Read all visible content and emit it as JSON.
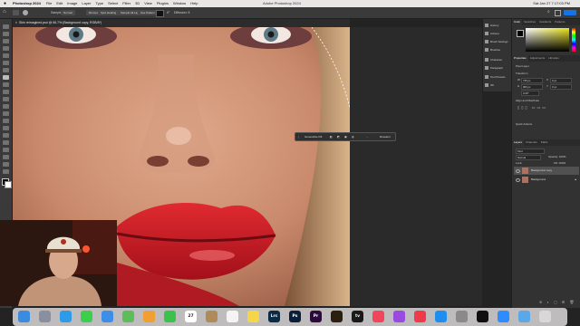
{
  "menubar": {
    "app_name": "Photoshop 2024",
    "menus": [
      "File",
      "Edit",
      "Image",
      "Layer",
      "Type",
      "Select",
      "Filter",
      "3D",
      "View",
      "Plugins",
      "Window",
      "Help"
    ],
    "window_title": "Adobe Photoshop 2024",
    "clock": "Sat Jan 27  7:17:03 PM"
  },
  "options": {
    "sample_label": "Sample:",
    "sample_value": "Normal",
    "btn_remove": "Remove",
    "btn_spot_heal": "Spot Healing",
    "btn_sample_all": "Sample All Layers",
    "btn_auto": "Use Pattern",
    "angle": "0°",
    "diffusion": "Diffusion:  5"
  },
  "document": {
    "tab_label": "Skin reimagined.psd @ 66.7% (Background copy, RGB/8*)"
  },
  "ctxbar": {
    "generative_fill": "Generative Fill",
    "deselect": "Deselect"
  },
  "dock_panels": [
    "History",
    "Actions",
    "Brush Settings",
    "Brushes",
    "Character",
    "Paragraph",
    "Tool Presets",
    "3D"
  ],
  "color_panel": {
    "tabs": [
      "Color",
      "Swatches",
      "Gradients",
      "Patterns"
    ]
  },
  "properties": {
    "tabs": [
      "Properties",
      "Adjustments",
      "Libraries"
    ],
    "pixel_layer": "Pixel Layer",
    "transform": "Transform",
    "w_label": "W",
    "w": "735 px",
    "h_label": "H",
    "h": "906 px",
    "x_label": "X",
    "x": "0 px",
    "y_label": "Y",
    "y": "0 px",
    "angle": "0.00°",
    "align": "Align and Distribute",
    "quick_actions": "Quick Actions"
  },
  "layers": {
    "tabs": [
      "Layers",
      "Channels",
      "Paths"
    ],
    "kind": "Kind",
    "blend": "Normal",
    "opacity": "Opacity: 100%",
    "lock": "Lock:",
    "fill": "Fill: 100%",
    "items": [
      {
        "name": "Background copy",
        "selected": true
      },
      {
        "name": "Background",
        "selected": false
      }
    ]
  },
  "macdock": {
    "apps": [
      {
        "name": "finder-icon",
        "label": "",
        "color": "#3b8be0"
      },
      {
        "name": "launchpad-icon",
        "label": "",
        "color": "#8a8fa0"
      },
      {
        "name": "safari-icon",
        "label": "",
        "color": "#2d9be8"
      },
      {
        "name": "messages-icon",
        "label": "",
        "color": "#3ccf4e"
      },
      {
        "name": "mail-icon",
        "label": "",
        "color": "#3b8fe8"
      },
      {
        "name": "maps-icon",
        "label": "",
        "color": "#5ebd5b"
      },
      {
        "name": "photos-icon",
        "label": "",
        "color": "#f0a030"
      },
      {
        "name": "facetime-icon",
        "label": "",
        "color": "#3ac24a"
      },
      {
        "name": "calendar-icon",
        "label": "27",
        "color": "#ffffff"
      },
      {
        "name": "contacts-icon",
        "label": "",
        "color": "#b08a5a"
      },
      {
        "name": "reminders-icon",
        "label": "",
        "color": "#f4f4f4"
      },
      {
        "name": "notes-icon",
        "label": "",
        "color": "#f6d649"
      },
      {
        "name": "lightroom-icon",
        "label": "Lrc",
        "color": "#0b2a44"
      },
      {
        "name": "photoshop-icon",
        "label": "Ps",
        "color": "#0a1e3a"
      },
      {
        "name": "premiere-icon",
        "label": "Pr",
        "color": "#2a0b3a"
      },
      {
        "name": "bridge-icon",
        "label": "",
        "color": "#2b1f10"
      },
      {
        "name": "appletv-icon",
        "label": "tv",
        "color": "#1a1a1a"
      },
      {
        "name": "music-icon",
        "label": "",
        "color": "#f2445a"
      },
      {
        "name": "podcasts-icon",
        "label": "",
        "color": "#9a4ae0"
      },
      {
        "name": "news-icon",
        "label": "",
        "color": "#f03a4a"
      },
      {
        "name": "appstore-icon",
        "label": "",
        "color": "#1e8ef0"
      },
      {
        "name": "settings-icon",
        "label": "",
        "color": "#8a8a8a"
      },
      {
        "name": "chatgpt-icon",
        "label": "",
        "color": "#101010"
      },
      {
        "name": "zoom-icon",
        "label": "",
        "color": "#2d8cff"
      },
      {
        "name": "folder-icon",
        "label": "",
        "color": "#5aa8e8"
      },
      {
        "name": "trash-icon",
        "label": "",
        "color": "#d8d8d8"
      }
    ]
  },
  "colors": {
    "ui_dark": "#323232",
    "accent_blue": "#1473e6",
    "lip_red": "#d8202a"
  }
}
